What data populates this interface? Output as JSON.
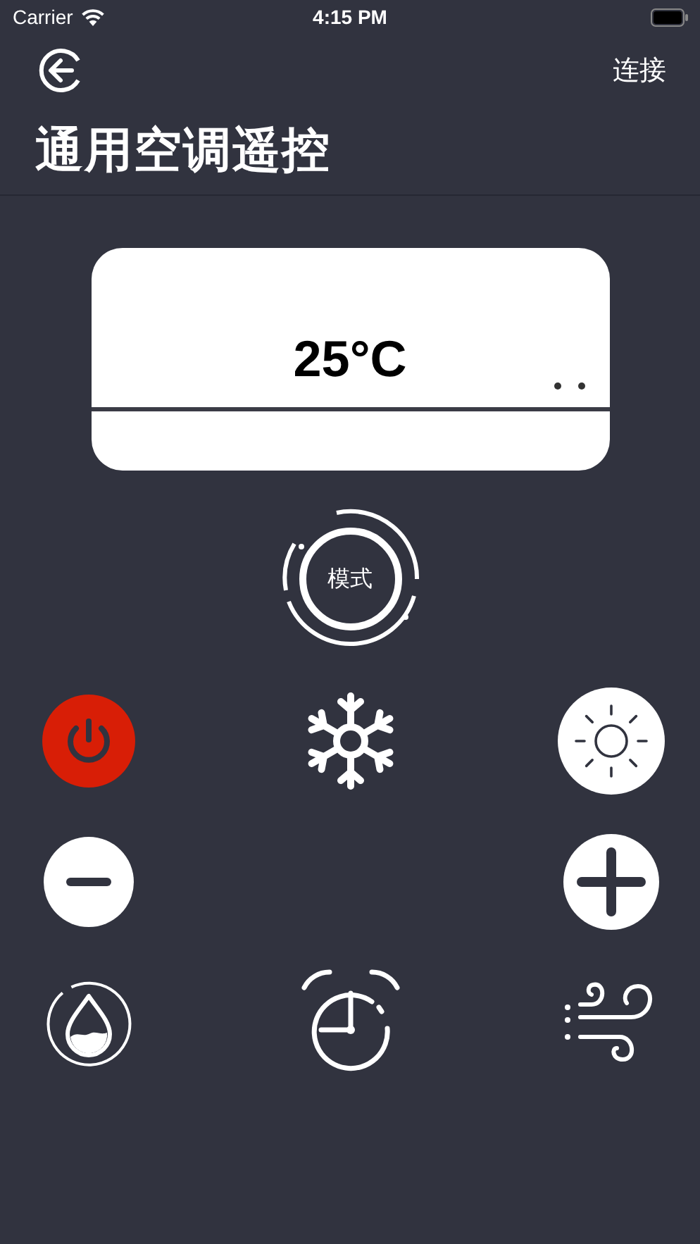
{
  "status_bar": {
    "carrier": "Carrier",
    "time": "4:15 PM"
  },
  "nav": {
    "action": "连接"
  },
  "title": "通用空调遥控",
  "display": {
    "temperature": "25°C"
  },
  "mode_button": {
    "label": "模式"
  },
  "power": {
    "on": true
  }
}
